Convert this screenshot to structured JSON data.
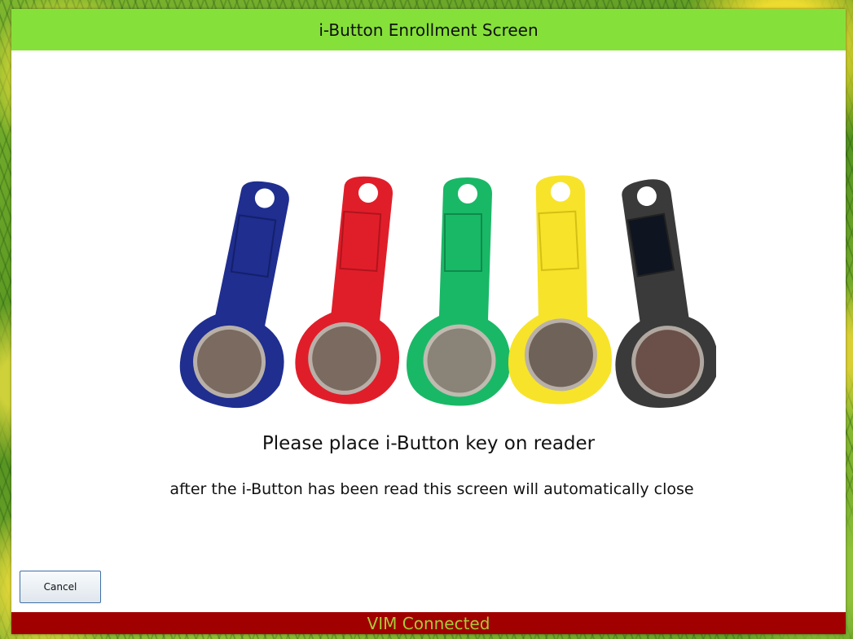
{
  "window": {
    "title": "i-Button Enrollment Screen"
  },
  "image": {
    "description_icon": "ibutton-keys-image",
    "key_colors": [
      "#1f2e8f",
      "#e01e2a",
      "#19b866",
      "#f7e32a",
      "#3a3a3a"
    ]
  },
  "main": {
    "prompt": "Please place i-Button key on reader",
    "subtext": "after the i-Button has been read this screen will automatically close"
  },
  "buttons": {
    "cancel_label": "Cancel"
  },
  "status": {
    "text": "VIM Connected",
    "bar_color": "#a10000",
    "text_color": "#a9c93a"
  },
  "colors": {
    "title_bar": "#86e03a"
  }
}
